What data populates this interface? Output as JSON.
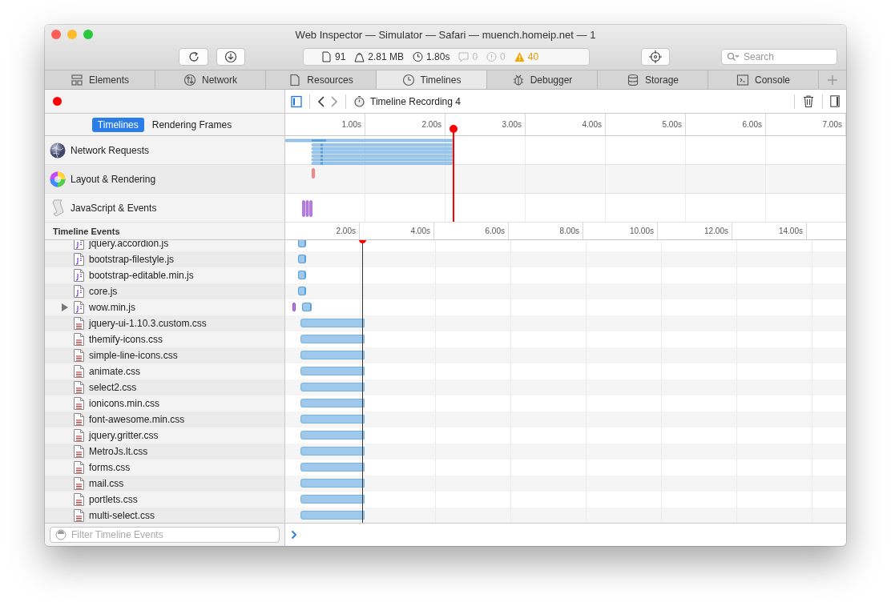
{
  "window": {
    "title": "Web Inspector — Simulator — Safari — muench.homeip.net — 1"
  },
  "dashboard": [
    {
      "kind": "resources",
      "text": "91",
      "active": true
    },
    {
      "kind": "size",
      "text": "2.81 MB",
      "active": true
    },
    {
      "kind": "time",
      "text": "1.80s",
      "active": true
    },
    {
      "kind": "logs",
      "text": "0",
      "active": false
    },
    {
      "kind": "errors",
      "text": "0",
      "active": false
    },
    {
      "kind": "warnings",
      "text": "40",
      "active": true
    }
  ],
  "search": {
    "placeholder": "Search"
  },
  "tabs": [
    {
      "kind": "elements",
      "label": "Elements",
      "selected": false
    },
    {
      "kind": "network",
      "label": "Network",
      "selected": false
    },
    {
      "kind": "resources",
      "label": "Resources",
      "selected": false
    },
    {
      "kind": "timelines",
      "label": "Timelines",
      "selected": true
    },
    {
      "kind": "debugger",
      "label": "Debugger",
      "selected": false
    },
    {
      "kind": "storage",
      "label": "Storage",
      "selected": false
    },
    {
      "kind": "console",
      "label": "Console",
      "selected": false
    }
  ],
  "recording": {
    "active": true,
    "title": "Timeline Recording 4"
  },
  "overview": {
    "modes": [
      {
        "label": "Timelines",
        "selected": true
      },
      {
        "label": "Rendering Frames",
        "selected": false
      }
    ],
    "ticks": [
      "1.00s",
      "2.00s",
      "3.00s",
      "4.00s",
      "5.00s",
      "6.00s",
      "7.00s"
    ],
    "timelines": [
      {
        "kind": "network",
        "label": "Network Requests"
      },
      {
        "kind": "layout",
        "label": "Layout & Rendering"
      },
      {
        "kind": "script",
        "label": "JavaScript & Events"
      }
    ]
  },
  "events": {
    "title": "Timeline Events",
    "ticks": [
      "2.00s",
      "4.00s",
      "6.00s",
      "8.00s",
      "10.00s",
      "12.00s",
      "14.00s"
    ],
    "rows": [
      {
        "kind": "js",
        "name": "jquery.accordion.js",
        "expandable": false
      },
      {
        "kind": "js",
        "name": "bootstrap-filestyle.js",
        "expandable": false
      },
      {
        "kind": "js",
        "name": "bootstrap-editable.min.js",
        "expandable": false
      },
      {
        "kind": "js",
        "name": "core.js",
        "expandable": false
      },
      {
        "kind": "js",
        "name": "wow.min.js",
        "expandable": true
      },
      {
        "kind": "css",
        "name": "jquery-ui-1.10.3.custom.css",
        "expandable": false
      },
      {
        "kind": "css",
        "name": "themify-icons.css",
        "expandable": false
      },
      {
        "kind": "css",
        "name": "simple-line-icons.css",
        "expandable": false
      },
      {
        "kind": "css",
        "name": "animate.css",
        "expandable": false
      },
      {
        "kind": "css",
        "name": "select2.css",
        "expandable": false
      },
      {
        "kind": "css",
        "name": "ionicons.min.css",
        "expandable": false
      },
      {
        "kind": "css",
        "name": "font-awesome.min.css",
        "expandable": false
      },
      {
        "kind": "css",
        "name": "jquery.gritter.css",
        "expandable": false
      },
      {
        "kind": "css",
        "name": "MetroJs.lt.css",
        "expandable": false
      },
      {
        "kind": "css",
        "name": "forms.css",
        "expandable": false
      },
      {
        "kind": "css",
        "name": "mail.css",
        "expandable": false
      },
      {
        "kind": "css",
        "name": "portlets.css",
        "expandable": false
      },
      {
        "kind": "css",
        "name": "multi-select.css",
        "expandable": false
      }
    ]
  },
  "filter": {
    "placeholder": "Filter Timeline Events"
  }
}
